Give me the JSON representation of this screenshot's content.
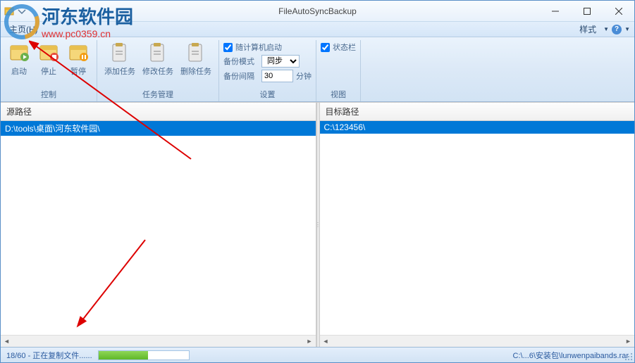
{
  "app": {
    "title": "FileAutoSyncBackup"
  },
  "menubar": {
    "home": "主页(H)",
    "style": "样式"
  },
  "ribbon": {
    "control": {
      "label": "控制",
      "start": "启动",
      "stop": "停止",
      "pause": "暂停"
    },
    "task": {
      "label": "任务管理",
      "add": "添加任务",
      "edit": "修改任务",
      "delete": "删除任务"
    },
    "settings": {
      "label": "设置",
      "startup_label": "随计算机启动",
      "startup_checked": true,
      "mode_label": "备份模式",
      "mode_value": "同步",
      "interval_label": "备份间隔",
      "interval_value": "30",
      "interval_unit": "分钟"
    },
    "view": {
      "label": "视图",
      "statusbar_label": "状态栏",
      "statusbar_checked": true
    }
  },
  "panels": {
    "source": {
      "header": "源路径",
      "row": "D:\\tools\\桌面\\河东软件园\\"
    },
    "target": {
      "header": "目标路径",
      "row": "C:\\123456\\"
    }
  },
  "statusbar": {
    "progress_text": "18/60 - 正在复制文件......",
    "progress_percent": 55,
    "path": "C:\\...6\\安装包\\lunwenpaibands.rar"
  },
  "watermark": {
    "text1": "河东软件园",
    "text2": "www.pc0359.cn"
  }
}
